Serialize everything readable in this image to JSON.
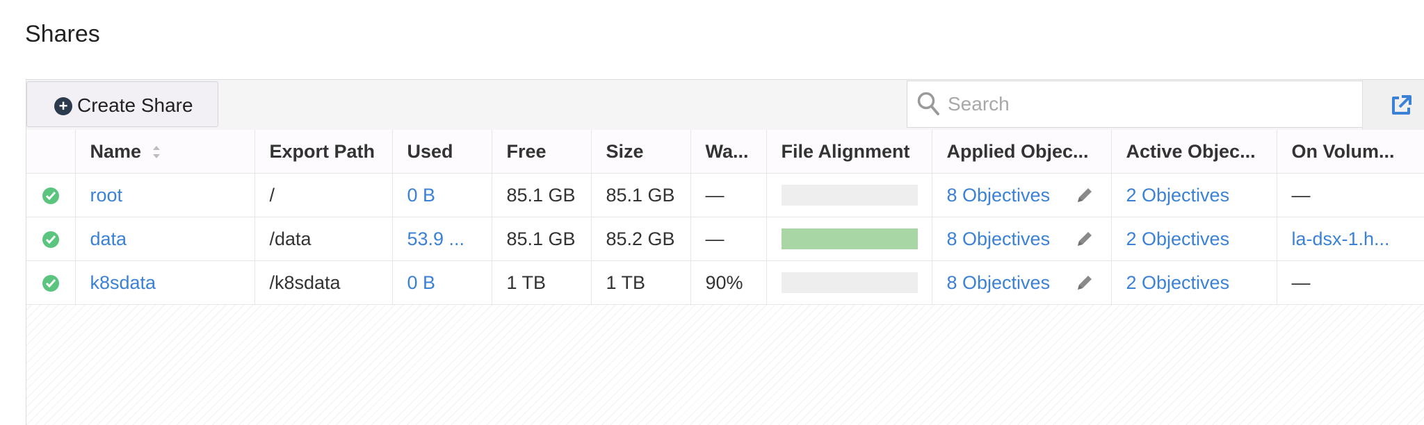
{
  "page": {
    "title": "Shares"
  },
  "toolbar": {
    "create_label": "Create Share",
    "search_placeholder": "Search",
    "icons": {
      "create": "plus-circle-icon",
      "search": "search-icon",
      "export": "external-link-icon"
    }
  },
  "table": {
    "columns": [
      {
        "key": "status",
        "label": ""
      },
      {
        "key": "name",
        "label": "Name"
      },
      {
        "key": "export_path",
        "label": "Export Path"
      },
      {
        "key": "used",
        "label": "Used"
      },
      {
        "key": "free",
        "label": "Free"
      },
      {
        "key": "size",
        "label": "Size"
      },
      {
        "key": "warn",
        "label": "Wa..."
      },
      {
        "key": "file_alignment",
        "label": "File Alignment"
      },
      {
        "key": "applied_objectives",
        "label": "Applied Objec..."
      },
      {
        "key": "active_objectives",
        "label": "Active Objec..."
      },
      {
        "key": "on_volume",
        "label": "On Volum..."
      }
    ],
    "rows": [
      {
        "name": "root",
        "export_path": "/",
        "used": "0 B",
        "free": "85.1 GB",
        "size": "85.1 GB",
        "warn": "—",
        "alignment": 0,
        "applied": "8 Objectives",
        "active": "2 Objectives",
        "on_volume": "—"
      },
      {
        "name": "data",
        "export_path": "/data",
        "used": "53.9 ...",
        "free": "85.1 GB",
        "size": "85.2 GB",
        "warn": "—",
        "alignment": 1,
        "applied": "8 Objectives",
        "active": "2 Objectives",
        "on_volume": "la-dsx-1.h..."
      },
      {
        "name": "k8sdata",
        "export_path": "/k8sdata",
        "used": "0 B",
        "free": "1 TB",
        "size": "1 TB",
        "warn": "90%",
        "alignment": 0,
        "applied": "8 Objectives",
        "active": "2 Objectives",
        "on_volume": "—"
      }
    ]
  },
  "colors": {
    "link": "#3b82d6",
    "ok": "#5bc47e",
    "alignment_fill": "#a8d6a4",
    "bar_bg": "#eeeeee"
  }
}
